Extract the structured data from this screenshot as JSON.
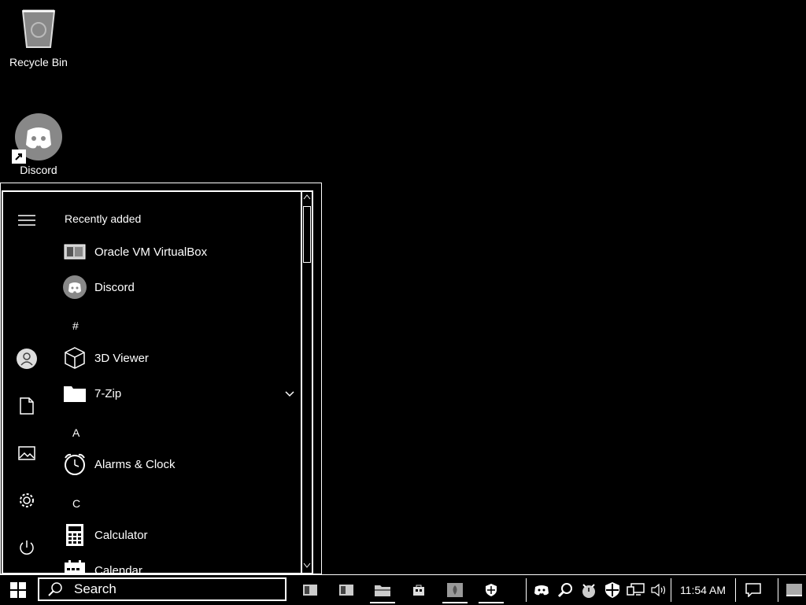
{
  "desktop": {
    "icons": [
      {
        "label": "Recycle Bin",
        "icon": "recycle-bin-icon"
      },
      {
        "label": "Discord",
        "icon": "discord-icon"
      }
    ]
  },
  "start_menu": {
    "recent_header": "Recently added",
    "recent": [
      {
        "name": "Oracle VM VirtualBox",
        "icon": "virtualbox-icon"
      },
      {
        "name": "Discord",
        "icon": "discord-icon"
      }
    ],
    "groups": [
      {
        "letter": "#",
        "apps": [
          {
            "name": "3D Viewer",
            "icon": "cube-icon"
          },
          {
            "name": "7-Zip",
            "icon": "folder-icon",
            "expandable": true
          }
        ]
      },
      {
        "letter": "A",
        "apps": [
          {
            "name": "Alarms & Clock",
            "icon": "alarm-clock-icon"
          }
        ]
      },
      {
        "letter": "C",
        "apps": [
          {
            "name": "Calculator",
            "icon": "calculator-icon"
          },
          {
            "name": "Calendar",
            "icon": "calendar-icon"
          }
        ]
      }
    ],
    "rail": [
      "hamburger-icon",
      "user-icon",
      "document-icon",
      "pictures-icon",
      "settings-icon",
      "power-icon"
    ]
  },
  "taskbar": {
    "search_placeholder": "Search",
    "clock": "11:54 AM",
    "colors": {
      "background": "#000000",
      "foreground": "#ffffff"
    }
  }
}
